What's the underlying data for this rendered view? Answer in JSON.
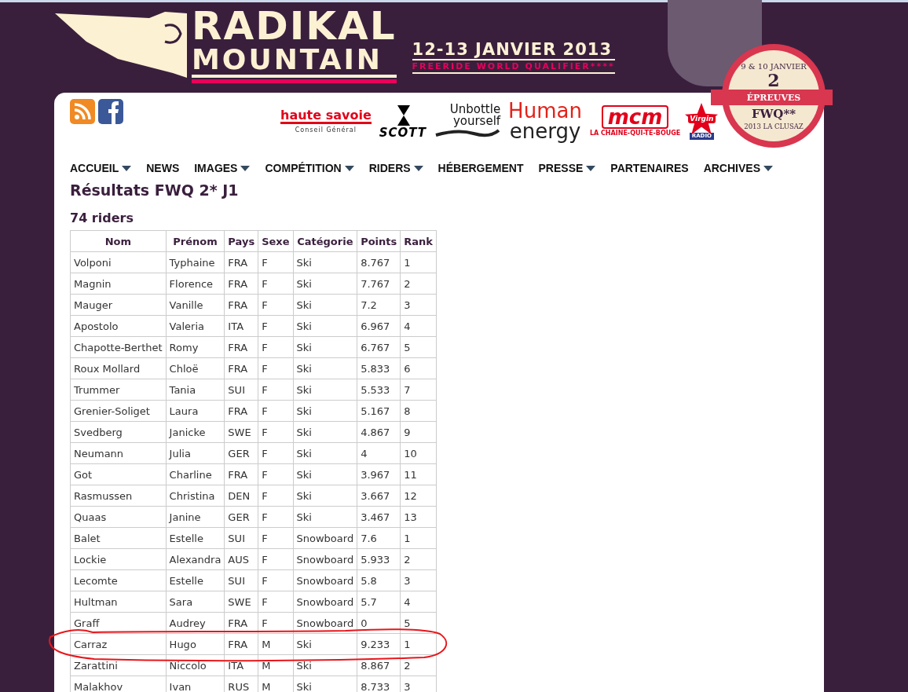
{
  "header": {
    "logo_top": "RADIKAL",
    "logo_bottom": "MOUNTAIN",
    "dates": "12-13 JANVIER 2013",
    "subtitle": "FREERIDE WORLD QUALIFIER****"
  },
  "badge": {
    "top": "9 & 10 JANVIER",
    "number": "2",
    "label": "ÉPREUVES",
    "event": "FWQ**",
    "bottom": "2013 LA CLUSAZ"
  },
  "sponsors": [
    {
      "kind": "savoie",
      "name": "haute savoie",
      "sub": "Conseil Général"
    },
    {
      "kind": "scott",
      "name": "SCOTT"
    },
    {
      "kind": "unbottle",
      "name": "Unbottle yourself"
    },
    {
      "kind": "human",
      "name": "Human",
      "sub": "energy"
    },
    {
      "kind": "mcm",
      "name": "mcm",
      "sub": "LA CHAINE-QUI-TE-BOUGE"
    },
    {
      "kind": "virgin",
      "name": "Virgin",
      "sub": "RADIO"
    }
  ],
  "nav": [
    {
      "label": "ACCUEIL",
      "dropdown": true
    },
    {
      "label": "NEWS",
      "dropdown": false
    },
    {
      "label": "IMAGES",
      "dropdown": true
    },
    {
      "label": "COMPÉTITION",
      "dropdown": true
    },
    {
      "label": "RIDERS",
      "dropdown": true
    },
    {
      "label": "HÉBERGEMENT",
      "dropdown": false
    },
    {
      "label": "PRESSE",
      "dropdown": true
    },
    {
      "label": "PARTENAIRES",
      "dropdown": false
    },
    {
      "label": "ARCHIVES",
      "dropdown": true
    }
  ],
  "page_title": "Résultats FWQ 2* J1",
  "count": "74 riders",
  "table": {
    "columns": [
      "Nom",
      "Prénom",
      "Pays",
      "Sexe",
      "Catégorie",
      "Points",
      "Rank"
    ],
    "rows": [
      {
        "cells": [
          "Volponi",
          "Typhaine",
          "FRA",
          "F",
          "Ski",
          "8.767",
          "1"
        ],
        "circled": false
      },
      {
        "cells": [
          "Magnin",
          "Florence",
          "FRA",
          "F",
          "Ski",
          "7.767",
          "2"
        ],
        "circled": false
      },
      {
        "cells": [
          "Mauger",
          "Vanille",
          "FRA",
          "F",
          "Ski",
          "7.2",
          "3"
        ],
        "circled": false
      },
      {
        "cells": [
          "Apostolo",
          "Valeria",
          "ITA",
          "F",
          "Ski",
          "6.967",
          "4"
        ],
        "circled": false
      },
      {
        "cells": [
          "Chapotte-Berthet",
          "Romy",
          "FRA",
          "F",
          "Ski",
          "6.767",
          "5"
        ],
        "circled": false
      },
      {
        "cells": [
          "Roux Mollard",
          "Chloë",
          "FRA",
          "F",
          "Ski",
          "5.833",
          "6"
        ],
        "circled": false
      },
      {
        "cells": [
          "Trummer",
          "Tania",
          "SUI",
          "F",
          "Ski",
          "5.533",
          "7"
        ],
        "circled": false
      },
      {
        "cells": [
          "Grenier-Soliget",
          "Laura",
          "FRA",
          "F",
          "Ski",
          "5.167",
          "8"
        ],
        "circled": false
      },
      {
        "cells": [
          "Svedberg",
          "Janicke",
          "SWE",
          "F",
          "Ski",
          "4.867",
          "9"
        ],
        "circled": false
      },
      {
        "cells": [
          "Neumann",
          "Julia",
          "GER",
          "F",
          "Ski",
          "4",
          "10"
        ],
        "circled": false
      },
      {
        "cells": [
          "Got",
          "Charline",
          "FRA",
          "F",
          "Ski",
          "3.967",
          "11"
        ],
        "circled": false
      },
      {
        "cells": [
          "Rasmussen",
          "Christina",
          "DEN",
          "F",
          "Ski",
          "3.667",
          "12"
        ],
        "circled": false
      },
      {
        "cells": [
          "Quaas",
          "Janine",
          "GER",
          "F",
          "Ski",
          "3.467",
          "13"
        ],
        "circled": false
      },
      {
        "cells": [
          "Balet",
          "Estelle",
          "SUI",
          "F",
          "Snowboard",
          "7.6",
          "1"
        ],
        "circled": false
      },
      {
        "cells": [
          "Lockie",
          "Alexandra",
          "AUS",
          "F",
          "Snowboard",
          "5.933",
          "2"
        ],
        "circled": false
      },
      {
        "cells": [
          "Lecomte",
          "Estelle",
          "SUI",
          "F",
          "Snowboard",
          "5.8",
          "3"
        ],
        "circled": false
      },
      {
        "cells": [
          "Hultman",
          "Sara",
          "SWE",
          "F",
          "Snowboard",
          "5.7",
          "4"
        ],
        "circled": false
      },
      {
        "cells": [
          "Graff",
          "Audrey",
          "FRA",
          "F",
          "Snowboard",
          "0",
          "5"
        ],
        "circled": false
      },
      {
        "cells": [
          "Carraz",
          "Hugo",
          "FRA",
          "M",
          "Ski",
          "9.233",
          "1"
        ],
        "circled": true
      },
      {
        "cells": [
          "Zarattini",
          "Niccolo",
          "ITA",
          "M",
          "Ski",
          "8.867",
          "2"
        ],
        "circled": false
      },
      {
        "cells": [
          "Malakhov",
          "Ivan",
          "RUS",
          "M",
          "Ski",
          "8.733",
          "3"
        ],
        "circled": false
      }
    ]
  }
}
